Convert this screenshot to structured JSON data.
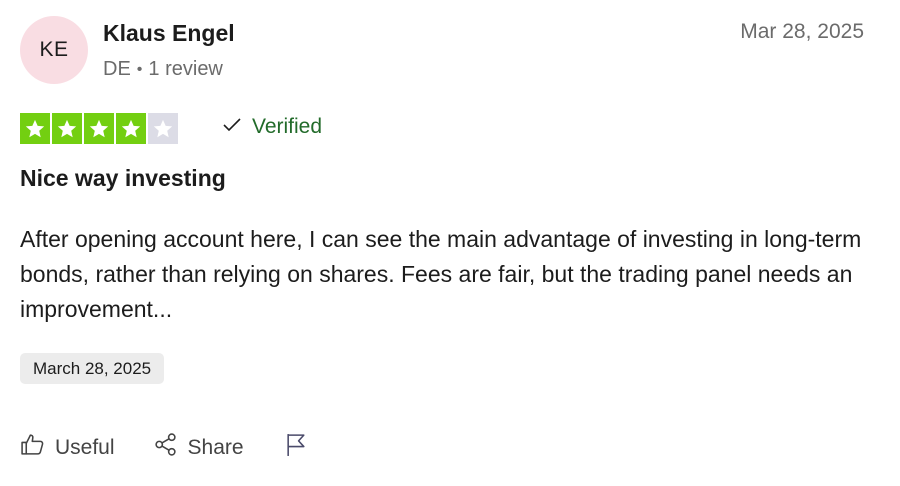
{
  "author": {
    "initials": "KE",
    "name": "Klaus Engel",
    "country": "DE",
    "review_count": "1 review"
  },
  "review": {
    "date_posted": "Mar 28, 2025",
    "rating": 4,
    "max_rating": 5,
    "verified_label": "Verified",
    "title": "Nice way investing",
    "body": "After opening account here, I can see the main advantage of investing in long-term bonds, rather than relying on shares. Fees are fair, but the trading panel needs an improvement...",
    "experience_date": "March 28, 2025"
  },
  "actions": {
    "useful_label": "Useful",
    "share_label": "Share"
  },
  "colors": {
    "star_filled": "#73cf11",
    "star_empty": "#dcdce6",
    "verified": "#226b2a",
    "avatar_bg": "#f9dde3"
  },
  "icons": [
    "check-icon",
    "thumbs-up-icon",
    "share-icon",
    "flag-icon",
    "star-icon"
  ]
}
